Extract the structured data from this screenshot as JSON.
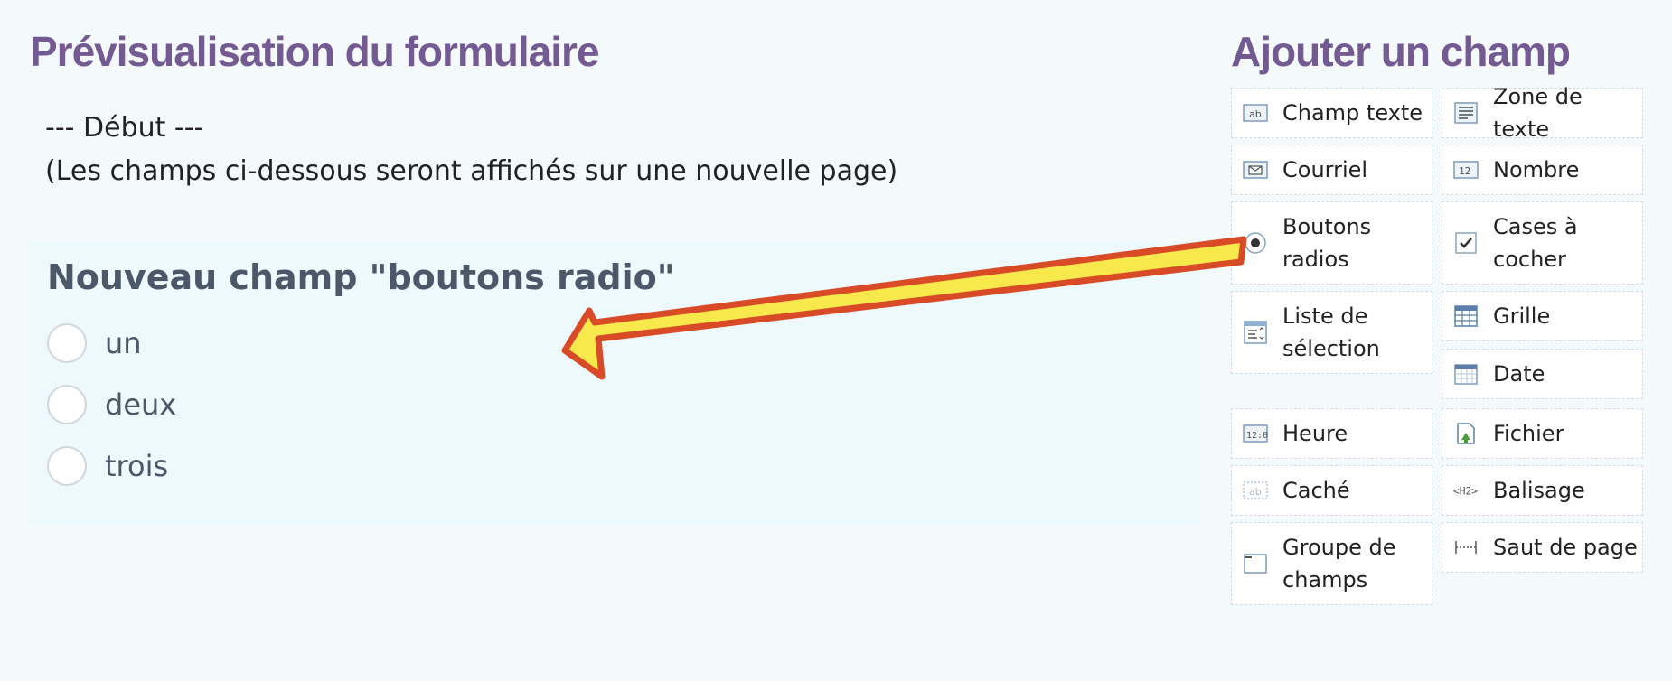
{
  "preview": {
    "title": "Prévisualisation du formulaire",
    "intro_line1": "--- Début ---",
    "intro_line2": "(Les champs ci-dessous seront affichés sur une nouvelle page)",
    "field": {
      "title": "Nouveau champ \"boutons radio\"",
      "options": [
        "un",
        "deux",
        "trois"
      ]
    }
  },
  "add_field": {
    "title": "Ajouter un champ",
    "left": [
      {
        "label": "Champ texte",
        "icon": "text-field-icon"
      },
      {
        "label": "Courriel",
        "icon": "email-icon"
      },
      {
        "label": "Boutons radios",
        "icon": "radio-icon"
      },
      {
        "label": "Liste de sélection",
        "icon": "select-list-icon"
      },
      {
        "label": "Heure",
        "icon": "time-icon"
      },
      {
        "label": "Caché",
        "icon": "hidden-field-icon"
      },
      {
        "label": "Groupe de champs",
        "icon": "fieldset-icon"
      }
    ],
    "right": [
      {
        "label": "Zone de texte",
        "icon": "textarea-icon"
      },
      {
        "label": "Nombre",
        "icon": "number-icon"
      },
      {
        "label": "Cases à cocher",
        "icon": "checkbox-icon"
      },
      {
        "label": "Grille",
        "icon": "grid-icon"
      },
      {
        "label": "Date",
        "icon": "calendar-icon"
      },
      {
        "label": "Fichier",
        "icon": "file-upload-icon"
      },
      {
        "label": "Balisage",
        "icon": "markup-icon"
      },
      {
        "label": "Saut de page",
        "icon": "page-break-icon"
      }
    ]
  },
  "annotation": {
    "arrow_fill": "#f7e94c",
    "arrow_stroke": "#d94b27"
  }
}
